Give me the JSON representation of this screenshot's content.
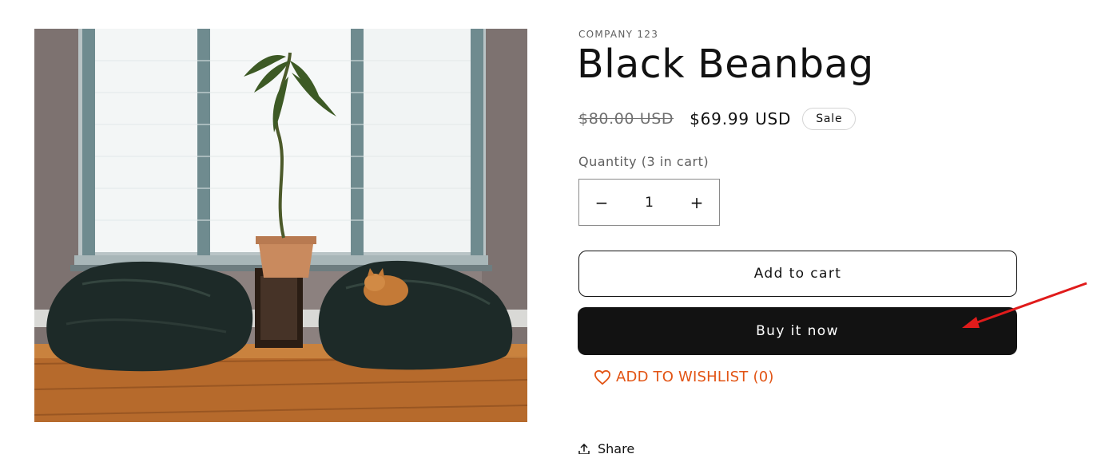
{
  "product": {
    "vendor": "COMPANY 123",
    "title": "Black Beanbag",
    "price_compare": "$80.00 USD",
    "price_sale": "$69.99 USD",
    "badge": "Sale",
    "image_alt": "Two black beanbags by a window with a cat and a plant"
  },
  "quantity": {
    "label": "Quantity (3 in cart)",
    "value": "1",
    "minus": "−",
    "plus": "+"
  },
  "actions": {
    "add_to_cart": "Add to cart",
    "buy_now": "Buy it now",
    "wishlist_label": "ADD TO WISHLIST",
    "wishlist_count": "(0)",
    "share": "Share"
  },
  "colors": {
    "accent_orange": "#e25414",
    "button_dark": "#121212",
    "annotation_red": "#e01b1b"
  },
  "icons": {
    "heart": "heart-icon",
    "share": "share-icon",
    "annotation": "red-arrow-annotation"
  }
}
